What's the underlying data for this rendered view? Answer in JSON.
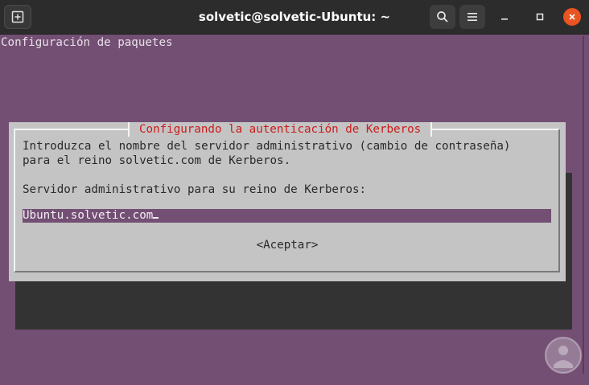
{
  "window": {
    "title": "solvetic@solvetic-Ubuntu: ~"
  },
  "terminal": {
    "heading": "Configuración de paquetes",
    "dialog": {
      "title": "Configurando la autenticación de Kerberos",
      "line1": "Introduzca el nombre del servidor administrativo (cambio de contraseña)",
      "line2": "para el reino solvetic.com de Kerberos.",
      "prompt": "Servidor administrativo para su reino de Kerberos:",
      "input_value": "Ubuntu.solvetic.com",
      "ok_button": "<Aceptar>"
    }
  },
  "colors": {
    "terminal_bg": "#734f74",
    "dialog_bg": "#c4c4c4",
    "title_red": "#cc1b1b",
    "close_orange": "#e95420"
  },
  "icons": [
    "new-tab-icon",
    "search-icon",
    "hamburger-menu-icon",
    "minimize-icon",
    "maximize-icon",
    "close-icon"
  ]
}
